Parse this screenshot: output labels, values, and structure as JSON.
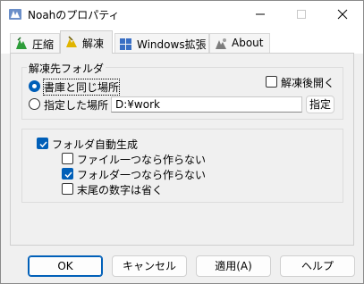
{
  "window": {
    "title": "Noahのプロパティ"
  },
  "titlebar": {
    "minimize_icon": "minimize-icon",
    "maximize_icon": "maximize-icon",
    "close_icon": "close-icon"
  },
  "tabs": [
    {
      "label": "圧縮",
      "icon": "compress-icon"
    },
    {
      "label": "解凍",
      "icon": "extract-icon",
      "selected": true
    },
    {
      "label": "Windows拡張",
      "icon": "windows-ext-icon"
    },
    {
      "label": "About",
      "icon": "about-icon"
    }
  ],
  "extract_folder": {
    "legend": "解凍先フォルダ",
    "same_place_label": "書庫と同じ場所",
    "same_place_checked": true,
    "specified_label": "指定した場所",
    "specified_checked": false,
    "path_value": "D:¥work",
    "specify_button": "指定",
    "open_after_label": "解凍後開く",
    "open_after_checked": false
  },
  "auto_folder": {
    "label": "フォルダ自動生成",
    "checked": true,
    "options": [
      {
        "label": "ファイル一つなら作らない",
        "checked": false
      },
      {
        "label": "フォルダ一つなら作らない",
        "checked": true
      },
      {
        "label": "末尾の数字は省く",
        "checked": false
      }
    ]
  },
  "buttons": {
    "ok": "OK",
    "cancel": "キャンセル",
    "apply": "適用(A)",
    "help": "ヘルプ"
  },
  "colors": {
    "accent": "#005fb8",
    "window_bg": "#f0f0f0",
    "titlebar_bg": "#ffffff"
  }
}
